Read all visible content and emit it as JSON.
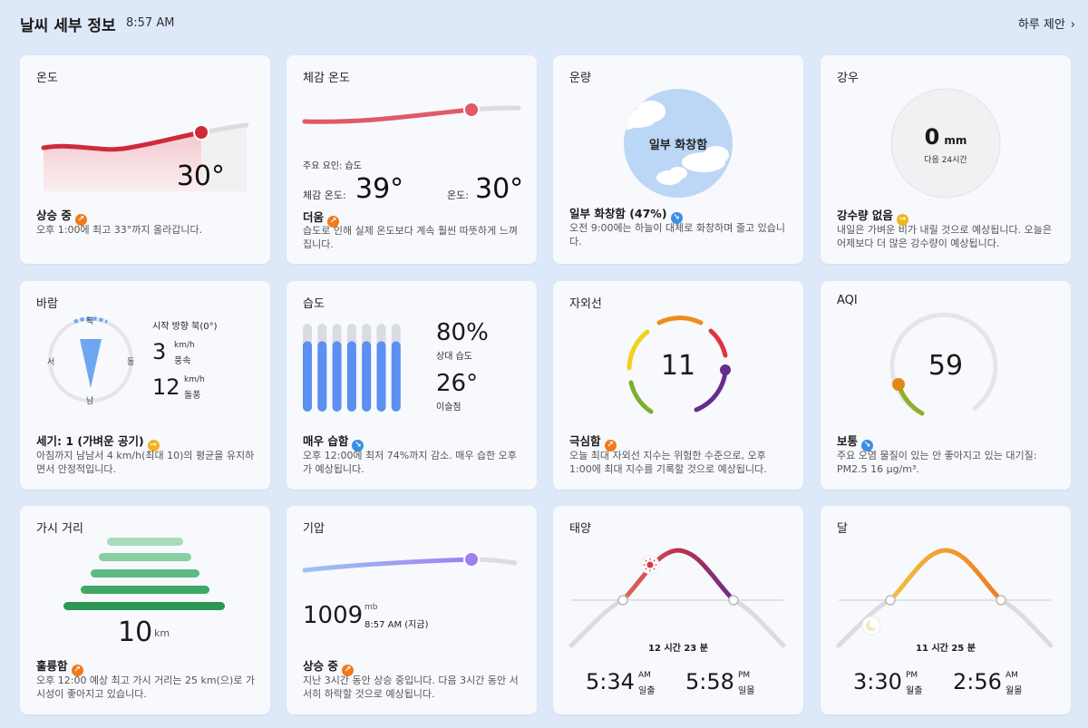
{
  "header": {
    "title": "날씨 세부 정보",
    "time": "8:57 AM",
    "suggest": "하루 제안"
  },
  "temperature": {
    "title": "온도",
    "value": "30°",
    "status": "상승 중",
    "desc": "오후 1:00에 최고 33°까지 올라갑니다."
  },
  "feels": {
    "title": "체감 온도",
    "factor": "주요 요인: 습도",
    "feels_label": "체감 온도:",
    "feels_value": "39°",
    "temp_label": "온도:",
    "temp_value": "30°",
    "status": "더움",
    "desc": "습도로 인해 실제 온도보다 계속 훨씬 따뜻하게 느껴집니다."
  },
  "cloud": {
    "title": "운량",
    "circle_label": "일부 화창함",
    "status": "일부 화창함 (47%)",
    "desc": "오전 9:00에는 하늘이 대체로 화창하며 줄고 있습니다."
  },
  "rain": {
    "title": "강우",
    "value": "0",
    "unit": "mm",
    "period": "다음 24시간",
    "status": "강수량 없음",
    "desc": "내일은 가벼운 비가 내릴 것으로 예상됩니다. 오늘은 어제보다 더 많은 강수량이 예상됩니다."
  },
  "wind": {
    "title": "바람",
    "north": "북",
    "south": "남",
    "east": "동",
    "west": "서",
    "start_dir": "시작 방향 북(0°)",
    "speed": "3",
    "speed_unit": "km/h",
    "speed_label": "풍속",
    "gust": "12",
    "gust_unit": "km/h",
    "gust_label": "돌풍",
    "status": "세기: 1 (가벼운 공기)",
    "desc": "아침까지 남남서 4 km/h(최대 10)의 평균을 유지하면서 안정적입니다."
  },
  "humidity": {
    "title": "습도",
    "value": "80%",
    "value_label": "상대 습도",
    "dew": "26°",
    "dew_label": "이슬점",
    "bars": [
      0.8,
      0.8,
      0.8,
      0.8,
      0.8,
      0.8,
      0.8
    ],
    "status": "매우 습함",
    "desc": "오후 12:00에 최저 74%까지 감소. 매우 습한 오후가 예상됩니다."
  },
  "uv": {
    "title": "자외선",
    "value": "11",
    "status": "극심함",
    "desc": "오늘 최대 자외선 지수는 위험한 수준으로, 오후 1:00에 최대 지수를 기록할 것으로 예상됩니다."
  },
  "aqi": {
    "title": "AQI",
    "value": "59",
    "status": "보통",
    "desc": "주요 오염 물질이 있는 안 좋아지고 있는 대기질: PM2.5 16 μg/m³."
  },
  "visibility": {
    "title": "가시 거리",
    "value": "10",
    "unit": "km",
    "status": "훌륭함",
    "desc": "오후 12:00 예상 최고 가시 거리는 25 km(으)로 가시성이 좋아지고 있습니다."
  },
  "pressure": {
    "title": "기압",
    "value": "1009",
    "unit": "mb",
    "time": "8:57 AM (지금)",
    "status": "상승 중",
    "desc": "지난 3시간 동안 상승 중입니다. 다음 3시간 동안 서서히 하락할 것으로 예상됩니다."
  },
  "sun": {
    "title": "태양",
    "duration": "12 시간 23 분",
    "rise": "5:34",
    "rise_ampm": "AM",
    "rise_label": "일출",
    "set": "5:58",
    "set_ampm": "PM",
    "set_label": "일몰"
  },
  "moon": {
    "title": "달",
    "duration": "11 시간 25 분",
    "rise": "3:30",
    "rise_ampm": "PM",
    "rise_label": "월출",
    "set": "2:56",
    "set_ampm": "AM",
    "set_label": "월몰"
  },
  "colors": {
    "temp": "#cf2a3a",
    "feels": "#e05a68",
    "uv_high": "#6a2b8e",
    "aqi": "#e08a12",
    "humidity": "#5b8ff0",
    "pressure": "#a07ef0",
    "visibility": "#2e9e5a"
  }
}
